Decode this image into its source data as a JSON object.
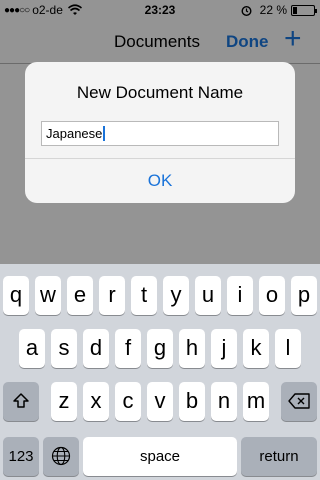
{
  "status": {
    "carrier": "o2-de",
    "signal_dots": "●●●○○",
    "time": "23:23",
    "battery_pct": "22 %",
    "battery_level": 0.22
  },
  "nav": {
    "title": "Documents",
    "done_label": "Done",
    "add_label": "+"
  },
  "alert": {
    "title": "New Document Name",
    "input_value": "Japanese",
    "ok_label": "OK"
  },
  "keyboard": {
    "row1": [
      "q",
      "w",
      "e",
      "r",
      "t",
      "y",
      "u",
      "i",
      "o",
      "p"
    ],
    "row2": [
      "a",
      "s",
      "d",
      "f",
      "g",
      "h",
      "j",
      "k",
      "l"
    ],
    "row3": [
      "z",
      "x",
      "c",
      "v",
      "b",
      "n",
      "m"
    ],
    "numbers_label": "123",
    "space_label": "space",
    "return_label": "return",
    "icons": {
      "shift": "shift-icon",
      "delete": "delete-icon",
      "globe": "globe-icon"
    }
  },
  "colors": {
    "accent": "#1a73d9",
    "keyboard_bg": "#d1d5db",
    "key_dark": "#aab0b9"
  }
}
